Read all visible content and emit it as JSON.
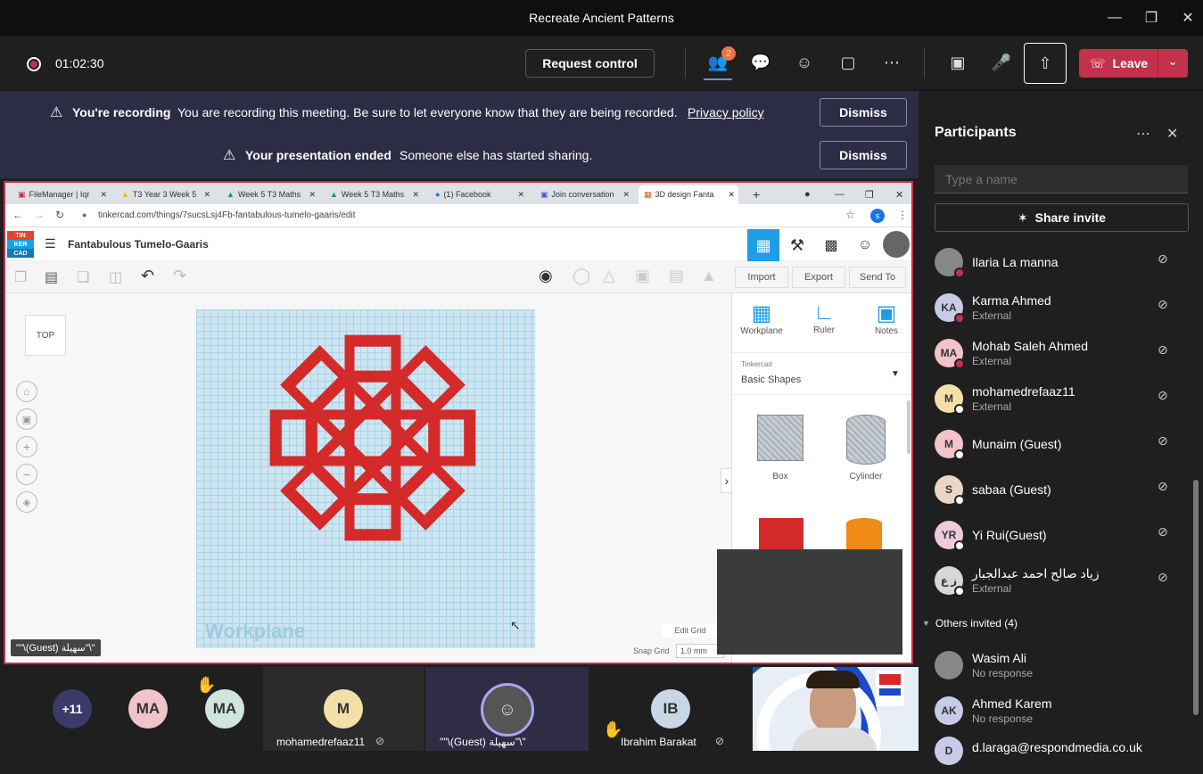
{
  "window": {
    "title": "Recreate Ancient Patterns"
  },
  "toolbar": {
    "timer": "01:02:30",
    "request_control": "Request control",
    "people_badge": "2",
    "leave": "Leave"
  },
  "banners": [
    {
      "title": "You're recording",
      "text": "You are recording this meeting. Be sure to let everyone know that they are being recorded.",
      "link": "Privacy policy",
      "button": "Dismiss"
    },
    {
      "title": "Your presentation ended",
      "text": "Someone else has started sharing.",
      "button": "Dismiss"
    }
  ],
  "shared": {
    "tabs": [
      "FileManager | Iqr",
      "T3 Year 3 Week 5",
      "Week 5 T3 Maths",
      "Week 5 T3 Maths",
      "(1) Facebook",
      "Join conversation",
      "3D design Fanta"
    ],
    "url": "tinkercad.com/things/7sucsLsj4Fb-fantabulous-tumelo-gaaris/edit",
    "logo": [
      "TIN",
      "KER",
      "CAD"
    ],
    "design_title": "Fantabulous Tumelo-Gaaris",
    "actions": [
      "Import",
      "Export",
      "Send To"
    ],
    "view_cube": "TOP",
    "tools": [
      "Workplane",
      "Ruler",
      "Notes"
    ],
    "library_source": "Tinkercad",
    "library_name": "Basic Shapes",
    "shapes": [
      "Box",
      "Cylinder"
    ],
    "workplane_label": "Workplane",
    "edit_grid": "Edit Grid",
    "snap_grid": "Snap Grid",
    "snap_value": "1.0 mm",
    "presenter_label": "\"\"\\(Guest) سهيلة\"\\\""
  },
  "sidebar": {
    "title": "Participants",
    "search_placeholder": "Type a name",
    "share_invite": "Share invite",
    "participants": [
      {
        "initials": "",
        "name": "Ilaria La manna",
        "sub": "",
        "color": "#888888"
      },
      {
        "initials": "KA",
        "name": "Karma Ahmed",
        "sub": "External",
        "color": "#c8cbe6"
      },
      {
        "initials": "MA",
        "name": "Mohab Saleh Ahmed",
        "sub": "External",
        "color": "#f2c3c8"
      },
      {
        "initials": "M",
        "name": "mohamedrefaaz11",
        "sub": "External",
        "color": "#f3e0a8"
      },
      {
        "initials": "M",
        "name": "Munaim (Guest)",
        "sub": "",
        "color": "#f2c3c8"
      },
      {
        "initials": "S",
        "name": "sabaa (Guest)",
        "sub": "",
        "color": "#ead6c6"
      },
      {
        "initials": "YR",
        "name": "Yi Rui(Guest)",
        "sub": "",
        "color": "#f0c9dd"
      },
      {
        "initials": "ز ع",
        "name": "زياد صالح احمد عبدالجبار",
        "sub": "External",
        "color": "#d7d7d7"
      }
    ],
    "others_label": "Others invited (4)",
    "others": [
      {
        "initials": "",
        "name": "Wasim Ali",
        "sub": "No response",
        "color": "#888888"
      },
      {
        "initials": "AK",
        "name": "Ahmed Karem",
        "sub": "No response",
        "color": "#c8cbe6"
      },
      {
        "initials": "D",
        "name": "d.laraga@respondmedia.co.uk",
        "sub": "",
        "color": "#c8cbe6"
      }
    ]
  },
  "bottom": {
    "overflow": "+11",
    "tiles": [
      {
        "initials": "MA",
        "name": "",
        "color": "#f2c3c8"
      },
      {
        "initials": "MA",
        "name": "",
        "color": "#cfe5e0"
      },
      {
        "initials": "M",
        "name": "mohamedrefaaz11",
        "color": "#f3e0a8"
      },
      {
        "initials": "",
        "name": "\"\"\\(Guest) سهيلة\"\\\"",
        "color": "#888888"
      },
      {
        "initials": "IB",
        "name": "Ibrahim Barakat",
        "color": "#c8d7e6"
      }
    ]
  }
}
